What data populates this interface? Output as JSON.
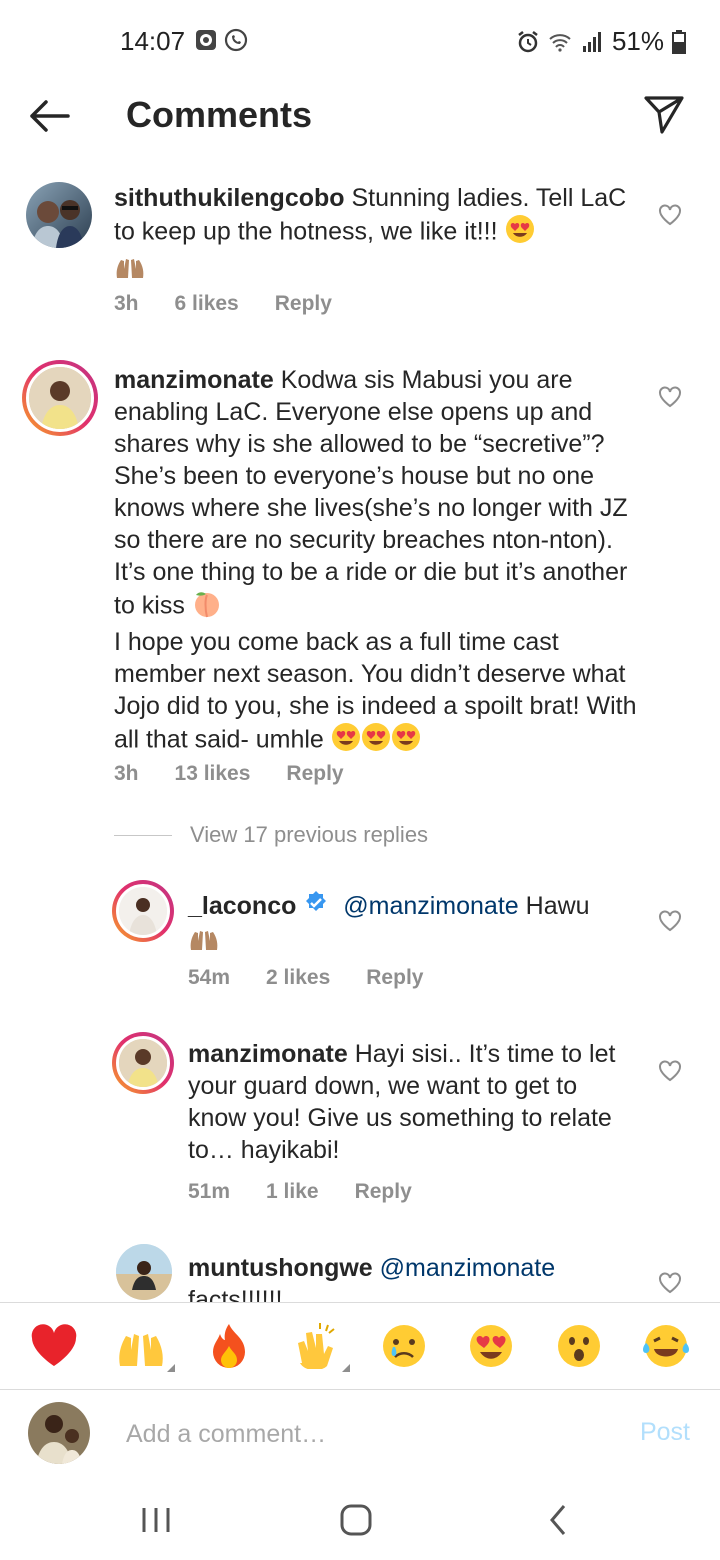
{
  "status_bar": {
    "time": "14:07",
    "battery": "51%"
  },
  "header": {
    "title": "Comments"
  },
  "comments": [
    {
      "username": "sithuthukilengcobo",
      "text": "Stunning ladies. Tell LaC to keep up the hotness, we like it!!!",
      "time": "3h",
      "likes": "6 likes",
      "reply": "Reply"
    },
    {
      "username": "manzimonate",
      "text_1": "Kodwa sis Mabusi you are enabling LaC. Everyone else opens up and shares why is she allowed to be “secretive”? She’s been to everyone’s house but no one knows where she lives(she’s no longer with JZ so there are no security breaches nton-nton). It’s one thing to be a ride or die but it’s another to kiss",
      "text_2": "I hope you come back as a full time cast member next season. You didn’t deserve what Jojo did to you, she is indeed a spoilt brat! With all that said- umhle",
      "time": "3h",
      "likes": "13 likes",
      "reply": "Reply"
    }
  ],
  "view_replies": "View 17 previous replies",
  "replies": [
    {
      "username": "_laconco",
      "mention": "@manzimonate",
      "text": "Hawu",
      "time": "54m",
      "likes": "2 likes",
      "reply": "Reply"
    },
    {
      "username": "manzimonate",
      "text": "Hayi sisi.. It’s time to let your guard down, we want to get to know you! Give us something to relate to… hayikabi!",
      "time": "51m",
      "likes": "1 like",
      "reply": "Reply"
    },
    {
      "username": "muntushongwe",
      "mention": "@manzimonate",
      "text": "facts!!!!!!"
    }
  ],
  "emoji_bar": [
    "heart",
    "raising-hands",
    "fire",
    "clapping-hands",
    "crying-face",
    "heart-eyes",
    "surprised-face",
    "tears-of-joy"
  ],
  "comment_bar": {
    "placeholder": "Add a comment…",
    "post": "Post"
  },
  "colors": {
    "mention": "#00376b",
    "meta": "#8e8e8e",
    "post_disabled": "#b2dffc",
    "verified": "#3897f0"
  }
}
